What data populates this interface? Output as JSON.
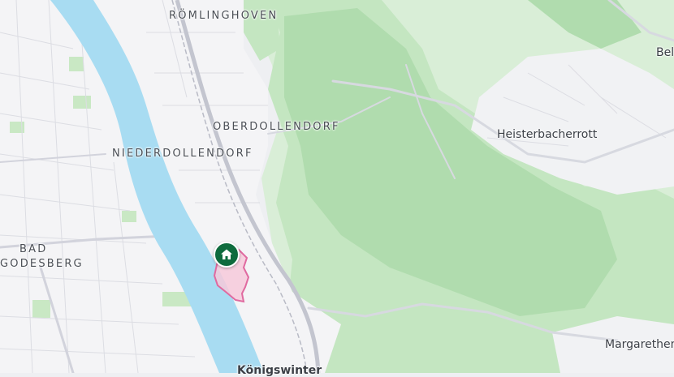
{
  "map": {
    "places": {
      "romlinghoven": "RÖMLINGHOVEN",
      "oberdollendorf": "OBERDOLLENDORF",
      "niederdollendorf": "NIEDERDOLLENDORF",
      "heisterbacherrott": "Heisterbacherrott",
      "bad": "BAD",
      "godesberg": "GODESBERG",
      "margarethen": "Margarethen",
      "bel": "Bel",
      "koenigswinter": "Königswinter"
    },
    "marker_icon": "home-icon",
    "colors": {
      "water": "#a8dcf2",
      "forest": "#bfe4bd",
      "forest_dark": "#a7d8a6",
      "urban": "#f4f4f6",
      "highlight_fill": "#f6c9da",
      "highlight_stroke": "#e06aa0",
      "marker": "#0e6b3d"
    }
  }
}
